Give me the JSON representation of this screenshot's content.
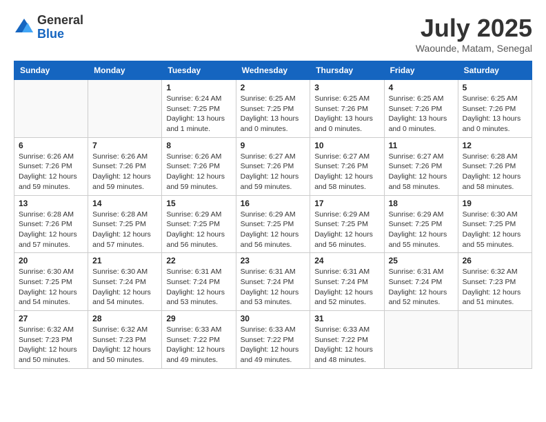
{
  "logo": {
    "general": "General",
    "blue": "Blue"
  },
  "title": "July 2025",
  "subtitle": "Waounde, Matam, Senegal",
  "weekdays": [
    "Sunday",
    "Monday",
    "Tuesday",
    "Wednesday",
    "Thursday",
    "Friday",
    "Saturday"
  ],
  "weeks": [
    [
      {
        "day": "",
        "info": ""
      },
      {
        "day": "",
        "info": ""
      },
      {
        "day": "1",
        "info": "Sunrise: 6:24 AM\nSunset: 7:25 PM\nDaylight: 13 hours and 1 minute."
      },
      {
        "day": "2",
        "info": "Sunrise: 6:25 AM\nSunset: 7:25 PM\nDaylight: 13 hours and 0 minutes."
      },
      {
        "day": "3",
        "info": "Sunrise: 6:25 AM\nSunset: 7:26 PM\nDaylight: 13 hours and 0 minutes."
      },
      {
        "day": "4",
        "info": "Sunrise: 6:25 AM\nSunset: 7:26 PM\nDaylight: 13 hours and 0 minutes."
      },
      {
        "day": "5",
        "info": "Sunrise: 6:25 AM\nSunset: 7:26 PM\nDaylight: 13 hours and 0 minutes."
      }
    ],
    [
      {
        "day": "6",
        "info": "Sunrise: 6:26 AM\nSunset: 7:26 PM\nDaylight: 12 hours and 59 minutes."
      },
      {
        "day": "7",
        "info": "Sunrise: 6:26 AM\nSunset: 7:26 PM\nDaylight: 12 hours and 59 minutes."
      },
      {
        "day": "8",
        "info": "Sunrise: 6:26 AM\nSunset: 7:26 PM\nDaylight: 12 hours and 59 minutes."
      },
      {
        "day": "9",
        "info": "Sunrise: 6:27 AM\nSunset: 7:26 PM\nDaylight: 12 hours and 59 minutes."
      },
      {
        "day": "10",
        "info": "Sunrise: 6:27 AM\nSunset: 7:26 PM\nDaylight: 12 hours and 58 minutes."
      },
      {
        "day": "11",
        "info": "Sunrise: 6:27 AM\nSunset: 7:26 PM\nDaylight: 12 hours and 58 minutes."
      },
      {
        "day": "12",
        "info": "Sunrise: 6:28 AM\nSunset: 7:26 PM\nDaylight: 12 hours and 58 minutes."
      }
    ],
    [
      {
        "day": "13",
        "info": "Sunrise: 6:28 AM\nSunset: 7:26 PM\nDaylight: 12 hours and 57 minutes."
      },
      {
        "day": "14",
        "info": "Sunrise: 6:28 AM\nSunset: 7:25 PM\nDaylight: 12 hours and 57 minutes."
      },
      {
        "day": "15",
        "info": "Sunrise: 6:29 AM\nSunset: 7:25 PM\nDaylight: 12 hours and 56 minutes."
      },
      {
        "day": "16",
        "info": "Sunrise: 6:29 AM\nSunset: 7:25 PM\nDaylight: 12 hours and 56 minutes."
      },
      {
        "day": "17",
        "info": "Sunrise: 6:29 AM\nSunset: 7:25 PM\nDaylight: 12 hours and 56 minutes."
      },
      {
        "day": "18",
        "info": "Sunrise: 6:29 AM\nSunset: 7:25 PM\nDaylight: 12 hours and 55 minutes."
      },
      {
        "day": "19",
        "info": "Sunrise: 6:30 AM\nSunset: 7:25 PM\nDaylight: 12 hours and 55 minutes."
      }
    ],
    [
      {
        "day": "20",
        "info": "Sunrise: 6:30 AM\nSunset: 7:25 PM\nDaylight: 12 hours and 54 minutes."
      },
      {
        "day": "21",
        "info": "Sunrise: 6:30 AM\nSunset: 7:24 PM\nDaylight: 12 hours and 54 minutes."
      },
      {
        "day": "22",
        "info": "Sunrise: 6:31 AM\nSunset: 7:24 PM\nDaylight: 12 hours and 53 minutes."
      },
      {
        "day": "23",
        "info": "Sunrise: 6:31 AM\nSunset: 7:24 PM\nDaylight: 12 hours and 53 minutes."
      },
      {
        "day": "24",
        "info": "Sunrise: 6:31 AM\nSunset: 7:24 PM\nDaylight: 12 hours and 52 minutes."
      },
      {
        "day": "25",
        "info": "Sunrise: 6:31 AM\nSunset: 7:24 PM\nDaylight: 12 hours and 52 minutes."
      },
      {
        "day": "26",
        "info": "Sunrise: 6:32 AM\nSunset: 7:23 PM\nDaylight: 12 hours and 51 minutes."
      }
    ],
    [
      {
        "day": "27",
        "info": "Sunrise: 6:32 AM\nSunset: 7:23 PM\nDaylight: 12 hours and 50 minutes."
      },
      {
        "day": "28",
        "info": "Sunrise: 6:32 AM\nSunset: 7:23 PM\nDaylight: 12 hours and 50 minutes."
      },
      {
        "day": "29",
        "info": "Sunrise: 6:33 AM\nSunset: 7:22 PM\nDaylight: 12 hours and 49 minutes."
      },
      {
        "day": "30",
        "info": "Sunrise: 6:33 AM\nSunset: 7:22 PM\nDaylight: 12 hours and 49 minutes."
      },
      {
        "day": "31",
        "info": "Sunrise: 6:33 AM\nSunset: 7:22 PM\nDaylight: 12 hours and 48 minutes."
      },
      {
        "day": "",
        "info": ""
      },
      {
        "day": "",
        "info": ""
      }
    ]
  ]
}
